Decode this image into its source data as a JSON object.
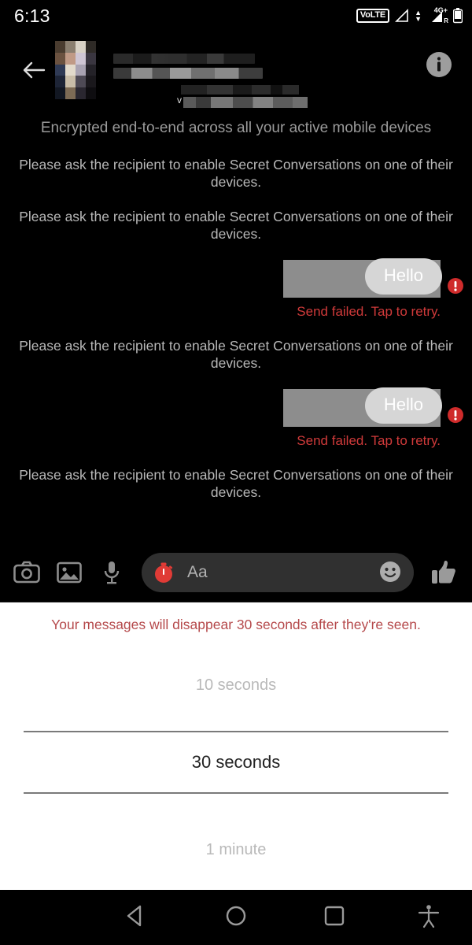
{
  "status_bar": {
    "time": "6:13",
    "volte_label": "VoLTE",
    "network_label": "4G",
    "network_plus": "+",
    "roaming_label": "R",
    "icons": [
      "volte-badge",
      "signal-triangle-icon",
      "data-arrows-icon",
      "signal-4g-icon",
      "battery-icon"
    ]
  },
  "header": {
    "back_icon": "back-arrow-icon",
    "avatar": "contact-avatar-pixelated",
    "contact_name_redacted": "",
    "contact_subtitle_redacted": "",
    "info_icon": "info-icon"
  },
  "thread": {
    "encryption_note": "Encrypted end-to-end across all your active mobile devices",
    "messages": [
      {
        "type": "system",
        "text": "Please ask the recipient to enable Secret Conversations on one of their devices."
      },
      {
        "type": "system",
        "text": "Please ask the recipient to enable Secret Conversations on one of their devices."
      },
      {
        "type": "outgoing",
        "text": "Hello",
        "status": "Send failed. Tap to retry.",
        "error_icon": "error-exclamation-icon"
      },
      {
        "type": "system",
        "text": "Please ask the recipient to enable Secret Conversations on one of their devices."
      },
      {
        "type": "outgoing",
        "text": "Hello",
        "status": "Send failed. Tap to retry.",
        "error_icon": "error-exclamation-icon"
      },
      {
        "type": "system",
        "text": "Please ask the recipient to enable Secret Conversations on one of their devices."
      }
    ]
  },
  "composer": {
    "camera_icon": "camera-icon",
    "gallery_icon": "gallery-icon",
    "microphone_icon": "microphone-icon",
    "timer_icon": "disappearing-timer-icon",
    "input_placeholder": "Aa",
    "input_value": "",
    "emoji_icon": "emoji-smiley-icon",
    "like_icon": "thumbs-up-icon"
  },
  "disappear_picker": {
    "warning": "Your messages will disappear 30 seconds after they're seen.",
    "options": [
      {
        "label": "10 seconds",
        "selected": false
      },
      {
        "label": "30 seconds",
        "selected": true
      },
      {
        "label": "1 minute",
        "selected": false
      }
    ]
  },
  "nav_bar": {
    "back_icon": "nav-back-icon",
    "home_icon": "nav-home-icon",
    "recents_icon": "nav-recents-icon",
    "accessibility_icon": "nav-accessibility-icon"
  },
  "colors": {
    "background": "#000000",
    "error_red": "#d03a3a",
    "timer_red": "#e03b36",
    "picker_background": "#ffffff",
    "warning_red": "#b5494b",
    "bubble_gray": "#d6d6d6"
  }
}
